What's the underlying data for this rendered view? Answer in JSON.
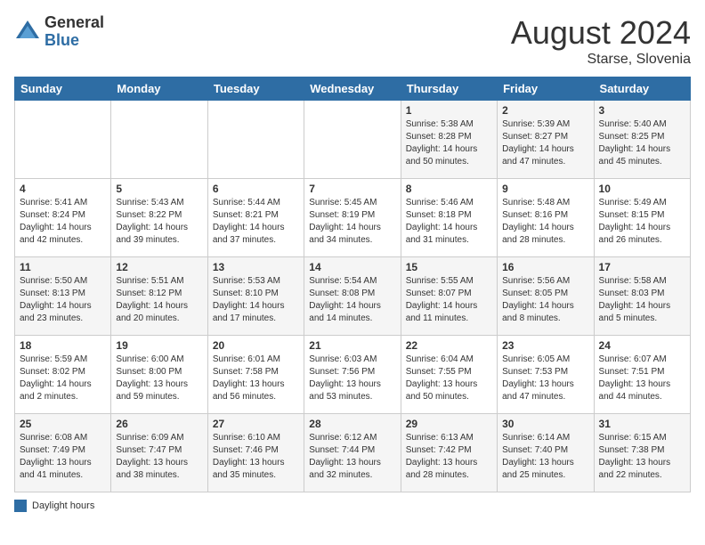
{
  "header": {
    "logo_general": "General",
    "logo_blue": "Blue",
    "month_year": "August 2024",
    "location": "Starse, Slovenia"
  },
  "days_of_week": [
    "Sunday",
    "Monday",
    "Tuesday",
    "Wednesday",
    "Thursday",
    "Friday",
    "Saturday"
  ],
  "legend_label": "Daylight hours",
  "weeks": [
    [
      {
        "day": "",
        "content": ""
      },
      {
        "day": "",
        "content": ""
      },
      {
        "day": "",
        "content": ""
      },
      {
        "day": "",
        "content": ""
      },
      {
        "day": "1",
        "content": "Sunrise: 5:38 AM\nSunset: 8:28 PM\nDaylight: 14 hours\nand 50 minutes."
      },
      {
        "day": "2",
        "content": "Sunrise: 5:39 AM\nSunset: 8:27 PM\nDaylight: 14 hours\nand 47 minutes."
      },
      {
        "day": "3",
        "content": "Sunrise: 5:40 AM\nSunset: 8:25 PM\nDaylight: 14 hours\nand 45 minutes."
      }
    ],
    [
      {
        "day": "4",
        "content": "Sunrise: 5:41 AM\nSunset: 8:24 PM\nDaylight: 14 hours\nand 42 minutes."
      },
      {
        "day": "5",
        "content": "Sunrise: 5:43 AM\nSunset: 8:22 PM\nDaylight: 14 hours\nand 39 minutes."
      },
      {
        "day": "6",
        "content": "Sunrise: 5:44 AM\nSunset: 8:21 PM\nDaylight: 14 hours\nand 37 minutes."
      },
      {
        "day": "7",
        "content": "Sunrise: 5:45 AM\nSunset: 8:19 PM\nDaylight: 14 hours\nand 34 minutes."
      },
      {
        "day": "8",
        "content": "Sunrise: 5:46 AM\nSunset: 8:18 PM\nDaylight: 14 hours\nand 31 minutes."
      },
      {
        "day": "9",
        "content": "Sunrise: 5:48 AM\nSunset: 8:16 PM\nDaylight: 14 hours\nand 28 minutes."
      },
      {
        "day": "10",
        "content": "Sunrise: 5:49 AM\nSunset: 8:15 PM\nDaylight: 14 hours\nand 26 minutes."
      }
    ],
    [
      {
        "day": "11",
        "content": "Sunrise: 5:50 AM\nSunset: 8:13 PM\nDaylight: 14 hours\nand 23 minutes."
      },
      {
        "day": "12",
        "content": "Sunrise: 5:51 AM\nSunset: 8:12 PM\nDaylight: 14 hours\nand 20 minutes."
      },
      {
        "day": "13",
        "content": "Sunrise: 5:53 AM\nSunset: 8:10 PM\nDaylight: 14 hours\nand 17 minutes."
      },
      {
        "day": "14",
        "content": "Sunrise: 5:54 AM\nSunset: 8:08 PM\nDaylight: 14 hours\nand 14 minutes."
      },
      {
        "day": "15",
        "content": "Sunrise: 5:55 AM\nSunset: 8:07 PM\nDaylight: 14 hours\nand 11 minutes."
      },
      {
        "day": "16",
        "content": "Sunrise: 5:56 AM\nSunset: 8:05 PM\nDaylight: 14 hours\nand 8 minutes."
      },
      {
        "day": "17",
        "content": "Sunrise: 5:58 AM\nSunset: 8:03 PM\nDaylight: 14 hours\nand 5 minutes."
      }
    ],
    [
      {
        "day": "18",
        "content": "Sunrise: 5:59 AM\nSunset: 8:02 PM\nDaylight: 14 hours\nand 2 minutes."
      },
      {
        "day": "19",
        "content": "Sunrise: 6:00 AM\nSunset: 8:00 PM\nDaylight: 13 hours\nand 59 minutes."
      },
      {
        "day": "20",
        "content": "Sunrise: 6:01 AM\nSunset: 7:58 PM\nDaylight: 13 hours\nand 56 minutes."
      },
      {
        "day": "21",
        "content": "Sunrise: 6:03 AM\nSunset: 7:56 PM\nDaylight: 13 hours\nand 53 minutes."
      },
      {
        "day": "22",
        "content": "Sunrise: 6:04 AM\nSunset: 7:55 PM\nDaylight: 13 hours\nand 50 minutes."
      },
      {
        "day": "23",
        "content": "Sunrise: 6:05 AM\nSunset: 7:53 PM\nDaylight: 13 hours\nand 47 minutes."
      },
      {
        "day": "24",
        "content": "Sunrise: 6:07 AM\nSunset: 7:51 PM\nDaylight: 13 hours\nand 44 minutes."
      }
    ],
    [
      {
        "day": "25",
        "content": "Sunrise: 6:08 AM\nSunset: 7:49 PM\nDaylight: 13 hours\nand 41 minutes."
      },
      {
        "day": "26",
        "content": "Sunrise: 6:09 AM\nSunset: 7:47 PM\nDaylight: 13 hours\nand 38 minutes."
      },
      {
        "day": "27",
        "content": "Sunrise: 6:10 AM\nSunset: 7:46 PM\nDaylight: 13 hours\nand 35 minutes."
      },
      {
        "day": "28",
        "content": "Sunrise: 6:12 AM\nSunset: 7:44 PM\nDaylight: 13 hours\nand 32 minutes."
      },
      {
        "day": "29",
        "content": "Sunrise: 6:13 AM\nSunset: 7:42 PM\nDaylight: 13 hours\nand 28 minutes."
      },
      {
        "day": "30",
        "content": "Sunrise: 6:14 AM\nSunset: 7:40 PM\nDaylight: 13 hours\nand 25 minutes."
      },
      {
        "day": "31",
        "content": "Sunrise: 6:15 AM\nSunset: 7:38 PM\nDaylight: 13 hours\nand 22 minutes."
      }
    ]
  ]
}
